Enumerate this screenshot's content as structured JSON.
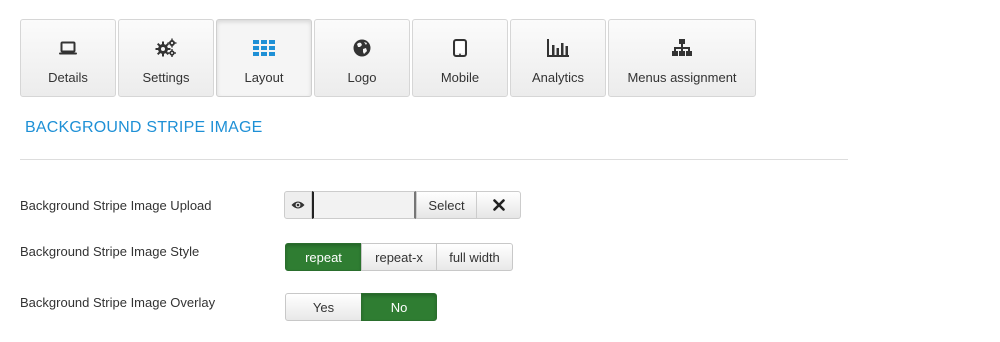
{
  "tabs": [
    {
      "label": "Details",
      "icon": "laptop-icon"
    },
    {
      "label": "Settings",
      "icon": "cogs-icon"
    },
    {
      "label": "Layout",
      "icon": "grid-icon",
      "active": true
    },
    {
      "label": "Logo",
      "icon": "globe-icon"
    },
    {
      "label": "Mobile",
      "icon": "tablet-icon"
    },
    {
      "label": "Analytics",
      "icon": "bar-chart-icon"
    },
    {
      "label": "Menus assignment",
      "icon": "sitemap-icon"
    }
  ],
  "section": {
    "title": "BACKGROUND STRIPE IMAGE"
  },
  "fields": {
    "upload": {
      "label": "Background Stripe Image Upload",
      "path_value": "",
      "select_label": "Select",
      "preview_icon": "eye-icon",
      "clear_icon": "close-icon"
    },
    "style": {
      "label": "Background Stripe Image Style",
      "options": [
        "repeat",
        "repeat-x",
        "full width"
      ],
      "selected": "repeat"
    },
    "overlay": {
      "label": "Background Stripe Image Overlay",
      "options": [
        "Yes",
        "No"
      ],
      "selected": "No"
    }
  },
  "colors": {
    "accent": "#1e90d6",
    "active_toggle": "#2f7d32"
  }
}
